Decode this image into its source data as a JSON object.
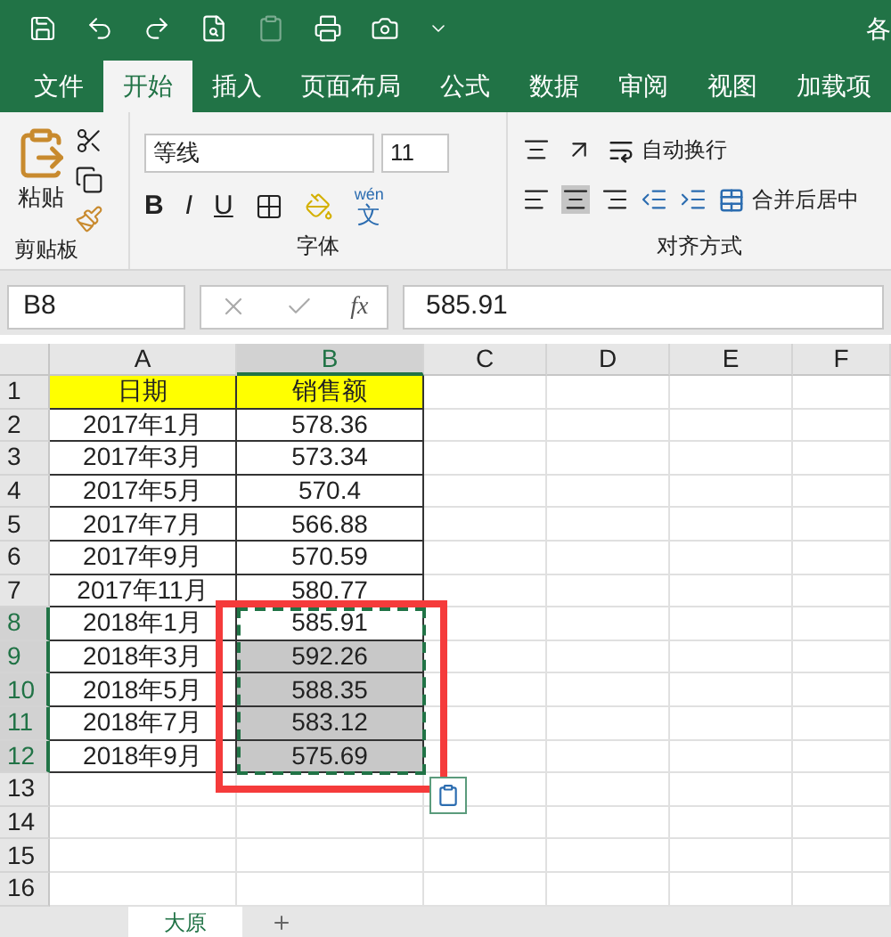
{
  "window": {
    "title": "各"
  },
  "tabs": [
    {
      "label": "文件",
      "selected": false
    },
    {
      "label": "开始",
      "selected": true
    },
    {
      "label": "插入",
      "selected": false
    },
    {
      "label": "页面布局",
      "selected": false
    },
    {
      "label": "公式",
      "selected": false
    },
    {
      "label": "数据",
      "selected": false
    },
    {
      "label": "审阅",
      "selected": false
    },
    {
      "label": "视图",
      "selected": false
    },
    {
      "label": "加载项",
      "selected": false
    }
  ],
  "ribbon": {
    "paste_label": "粘贴",
    "clipboard_group": "剪贴板",
    "font_name": "等线",
    "font_size": "11",
    "font_group": "字体",
    "bold": "B",
    "italic": "I",
    "underline": "U",
    "phonetic_top": "wén",
    "phonetic_bottom": "文",
    "wrap_text": "自动换行",
    "merge_center": "合并后居中",
    "alignment_group": "对齐方式"
  },
  "formula_bar": {
    "name_box": "B8",
    "fx": "fx",
    "value": "585.91"
  },
  "sheet": {
    "columns": [
      {
        "label": "A",
        "selected": false
      },
      {
        "label": "B",
        "selected": true
      },
      {
        "label": "C",
        "selected": false
      },
      {
        "label": "D",
        "selected": false
      },
      {
        "label": "E",
        "selected": false
      },
      {
        "label": "F",
        "selected": false
      }
    ],
    "rows": [
      {
        "number": "1",
        "date": "日期",
        "amount": "销售额",
        "kind": "header",
        "selected": false
      },
      {
        "number": "2",
        "date": "2017年1月",
        "amount": "578.36",
        "kind": "data",
        "selected": false
      },
      {
        "number": "3",
        "date": "2017年3月",
        "amount": "573.34",
        "kind": "data",
        "selected": false
      },
      {
        "number": "4",
        "date": "2017年5月",
        "amount": "570.4",
        "kind": "data",
        "selected": false
      },
      {
        "number": "5",
        "date": "2017年7月",
        "amount": "566.88",
        "kind": "data",
        "selected": false
      },
      {
        "number": "6",
        "date": "2017年9月",
        "amount": "570.59",
        "kind": "data",
        "selected": false
      },
      {
        "number": "7",
        "date": "2017年11月",
        "amount": "580.77",
        "kind": "data",
        "selected": false
      },
      {
        "number": "8",
        "date": "2018年1月",
        "amount": "585.91",
        "kind": "data",
        "selected": true
      },
      {
        "number": "9",
        "date": "2018年3月",
        "amount": "592.26",
        "kind": "data",
        "selected": true
      },
      {
        "number": "10",
        "date": "2018年5月",
        "amount": "588.35",
        "kind": "data",
        "selected": true
      },
      {
        "number": "11",
        "date": "2018年7月",
        "amount": "583.12",
        "kind": "data",
        "selected": true
      },
      {
        "number": "12",
        "date": "2018年9月",
        "amount": "575.69",
        "kind": "data",
        "selected": true
      },
      {
        "number": "13",
        "kind": "empty",
        "selected": false
      },
      {
        "number": "14",
        "kind": "empty",
        "selected": false
      },
      {
        "number": "15",
        "kind": "empty",
        "selected": false
      },
      {
        "number": "16",
        "kind": "empty",
        "selected": false
      }
    ]
  },
  "sheet_tabs": [
    {
      "label": "大原",
      "selected": true
    }
  ]
}
